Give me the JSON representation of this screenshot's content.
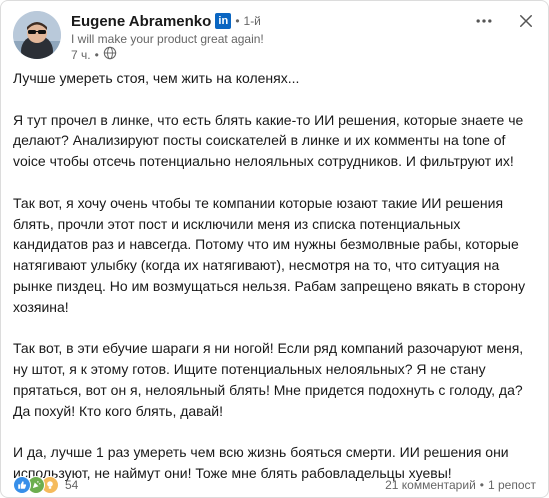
{
  "author": {
    "name": "Eugene Abramenko",
    "badge": "in",
    "separator": "•",
    "degree": "1-й",
    "headline": "I will make your product great again!",
    "time": "7 ч.",
    "time_separator": "•"
  },
  "post": {
    "paragraphs": [
      "Лучше умереть стоя, чем жить на коленях...",
      "Я тут прочел в линке, что есть блять какие-то ИИ решения, которые знаете че делают? Анализируют посты соискателей в линке и их комменты на tone of voice чтобы отсечь потенциально нелояльных сотрудников. И фильтруют их!",
      "Так вот, я хочу очень чтобы те компании которые юзают такие ИИ решения блять, прочли этот пост и исключили меня из списка потенциальных кандидатов раз и навсегда. Потому что им нужны безмолвные рабы, которые натягивают улыбку (когда их натягивают), несмотря на то, что ситуация на рынке пиздец. Но им возмущаться нельзя. Рабам запрещено вякать в сторону хозяина!",
      "Так вот, в эти ебучие шараги я ни ногой! Если ряд компаний разочаруют меня, ну штот, я к этому готов. Ищите потенциальных нелояльных? Я не стану прятаться, вот он я, нелояльный блять! Мне придется подохнуть с голоду, да? Да похуй! Кто кого блять, давай!",
      "И да, лучше 1 раз умереть чем всю жизнь бояться смерти. ИИ решения они используют, не наймут они! Тоже мне блять рабовладельцы хуевы!"
    ]
  },
  "social": {
    "reaction_count": "54",
    "comments": "21 комментарий",
    "separator": "•",
    "reposts": "1 репост"
  },
  "icons": {
    "more": "more-horizontal-icon",
    "close": "close-icon",
    "globe": "globe-icon",
    "like": "like-reaction-icon",
    "celebrate": "celebrate-reaction-icon",
    "insightful": "insightful-reaction-icon"
  },
  "colors": {
    "brand": "#0a66c2",
    "text": "#191919",
    "muted": "#666666",
    "like": "#378fe9",
    "celebrate": "#44712e",
    "insightful": "#f5bb5c"
  }
}
